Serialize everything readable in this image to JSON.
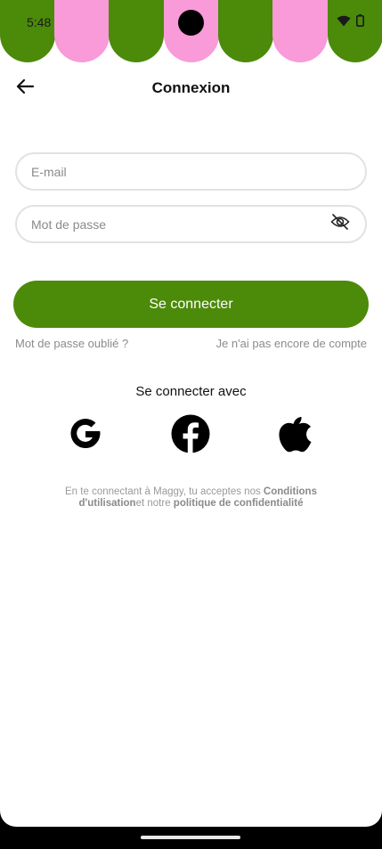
{
  "colors": {
    "brand_green": "#4c8a0a",
    "brand_pink": "#f99ad9",
    "text_dark": "#111111",
    "text_muted": "#8c8c8c",
    "field_border": "#e2e2e2"
  },
  "status_bar": {
    "time": "5:48",
    "icons": [
      "wifi-icon",
      "battery-icon"
    ]
  },
  "header": {
    "back_icon": "arrow-left-icon",
    "title": "Connexion"
  },
  "form": {
    "email_placeholder": "E-mail",
    "email_value": "",
    "password_placeholder": "Mot de passe",
    "password_value": "",
    "password_toggle_icon": "eye-off-icon",
    "submit_label": "Se connecter",
    "forgot_password": "Mot de passe oublié ?",
    "no_account": "Je n'ai pas encore de compte"
  },
  "social": {
    "title": "Se connecter avec",
    "providers": [
      {
        "name": "Google",
        "icon": "google-icon"
      },
      {
        "name": "Facebook",
        "icon": "facebook-icon"
      },
      {
        "name": "Apple",
        "icon": "apple-icon"
      }
    ]
  },
  "legal": {
    "prefix": "En te connectant à Maggy, tu acceptes nos ",
    "terms": "Conditions d'utilisation",
    "middle": "et notre ",
    "privacy": "politique de confidentialité"
  }
}
